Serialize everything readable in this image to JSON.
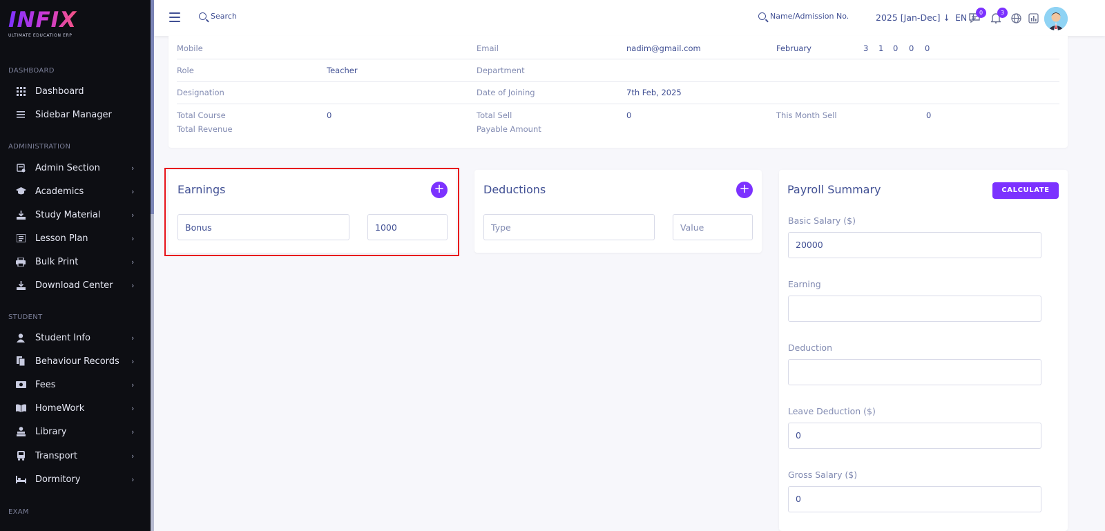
{
  "brand": {
    "logo_text": "INFIX",
    "tagline": "ULTIMATE EDUCATION ERP"
  },
  "sidebar": {
    "sections": [
      {
        "title": "DASHBOARD"
      },
      {
        "title": "ADMINISTRATION"
      },
      {
        "title": "STUDENT"
      },
      {
        "title": "EXAM"
      }
    ],
    "items": [
      {
        "label": "Dashboard",
        "icon": "grid-icon"
      },
      {
        "label": "Sidebar Manager",
        "icon": "menu-lines-icon"
      },
      {
        "label": "Admin Section",
        "icon": "admin-icon"
      },
      {
        "label": "Academics",
        "icon": "graduation-cap-icon"
      },
      {
        "label": "Study Material",
        "icon": "download-icon"
      },
      {
        "label": "Lesson Plan",
        "icon": "book-list-icon"
      },
      {
        "label": "Bulk Print",
        "icon": "printer-icon"
      },
      {
        "label": "Download Center",
        "icon": "download-icon"
      },
      {
        "label": "Student Info",
        "icon": "user-icon"
      },
      {
        "label": "Behaviour Records",
        "icon": "records-icon"
      },
      {
        "label": "Fees",
        "icon": "money-icon"
      },
      {
        "label": "HomeWork",
        "icon": "open-book-icon"
      },
      {
        "label": "Library",
        "icon": "library-icon"
      },
      {
        "label": "Transport",
        "icon": "bus-icon"
      },
      {
        "label": "Dormitory",
        "icon": "bed-icon"
      }
    ]
  },
  "topbar": {
    "search_label": "Search",
    "student_search_label": "Name/Admission No.",
    "session": "2025 [Jan-Dec]",
    "language": "EN",
    "messages_count": "0",
    "notifications_count": "3"
  },
  "info": {
    "mobile_label": "Mobile",
    "email_label": "Email",
    "email_value": "nadim@gmail.com",
    "month_label": "February",
    "month_stats": [
      "3",
      "1",
      "0",
      "0",
      "0"
    ],
    "role_label": "Role",
    "role_value": "Teacher",
    "department_label": "Department",
    "designation_label": "Designation",
    "joining_label": "Date of Joining",
    "joining_value": "7th Feb, 2025",
    "total_course_label": "Total Course",
    "total_course_value": "0",
    "total_sell_label": "Total Sell",
    "total_sell_value": "0",
    "month_sell_label": "This Month Sell",
    "month_sell_value": "0",
    "total_revenue_label": "Total Revenue",
    "payable_label": "Payable Amount"
  },
  "earnings": {
    "title": "Earnings",
    "type_value": "Bonus",
    "amount_value": "1000"
  },
  "deductions": {
    "title": "Deductions",
    "type_placeholder": "Type",
    "value_placeholder": "Value"
  },
  "payroll": {
    "title": "Payroll Summary",
    "calculate_label": "CALCULATE",
    "basic_salary_label": "Basic Salary ($)",
    "basic_salary_value": "20000",
    "earning_label": "Earning",
    "earning_value": "",
    "deduction_label": "Deduction",
    "deduction_value": "",
    "leave_deduction_label": "Leave Deduction ($)",
    "leave_deduction_value": "0",
    "gross_salary_label": "Gross Salary ($)",
    "gross_salary_value": "0"
  },
  "colors": {
    "accent": "#7c32ff",
    "text": "#415094",
    "muted": "#828bb2",
    "sidebar_bg": "#0d0e13",
    "highlight": "#e8131b"
  }
}
